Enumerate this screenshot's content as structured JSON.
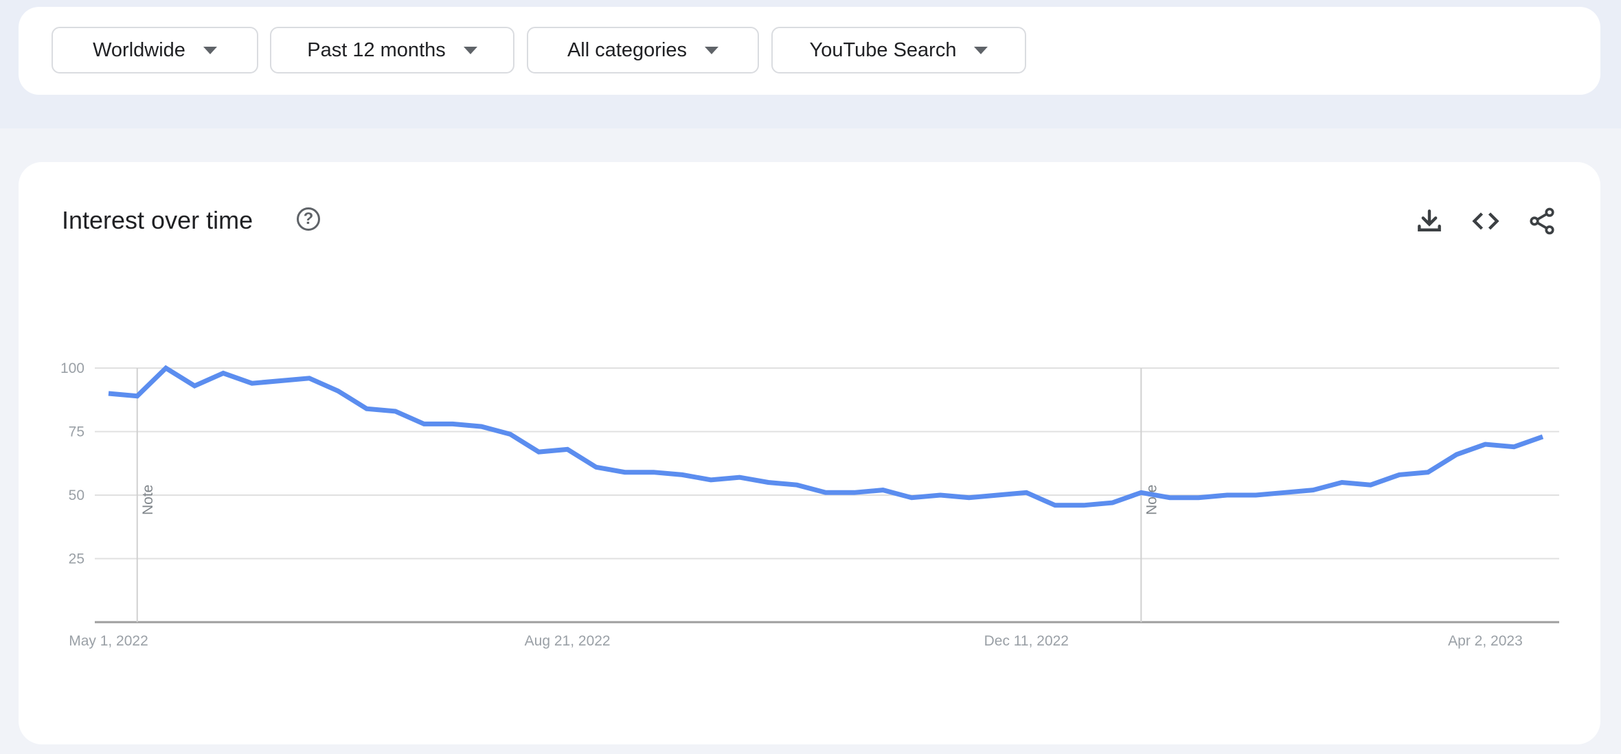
{
  "filters": [
    {
      "label": "Worldwide"
    },
    {
      "label": "Past 12 months"
    },
    {
      "label": "All categories"
    },
    {
      "label": "YouTube Search"
    }
  ],
  "card": {
    "title": "Interest over time",
    "help_icon": "help-circle-icon",
    "help_glyph": "?",
    "actions": [
      "download-icon",
      "embed-code-icon",
      "share-icon"
    ]
  },
  "chart_data": {
    "type": "line",
    "title": "",
    "xlabel": "",
    "ylabel": "",
    "ylim": [
      0,
      100
    ],
    "yticks": [
      25,
      50,
      75,
      100
    ],
    "grid": true,
    "line_color": "#5b8def",
    "start_date": "May 1, 2022",
    "interval": "weekly",
    "x_tick_labels": [
      {
        "label": "May 1, 2022",
        "index": 0
      },
      {
        "label": "Aug 21, 2022",
        "index": 16
      },
      {
        "label": "Dec 11, 2022",
        "index": 32
      },
      {
        "label": "Apr 2, 2023",
        "index": 48
      }
    ],
    "notes": [
      {
        "label": "Note",
        "index": 1
      },
      {
        "label": "Note",
        "index": 36
      }
    ],
    "values": [
      90,
      89,
      100,
      93,
      98,
      94,
      95,
      96,
      91,
      84,
      83,
      78,
      78,
      77,
      74,
      67,
      68,
      61,
      59,
      59,
      58,
      56,
      57,
      55,
      54,
      51,
      51,
      52,
      49,
      50,
      49,
      50,
      51,
      46,
      46,
      47,
      51,
      49,
      49,
      50,
      50,
      51,
      52,
      55,
      54,
      58,
      59,
      66,
      70,
      69,
      73
    ]
  }
}
